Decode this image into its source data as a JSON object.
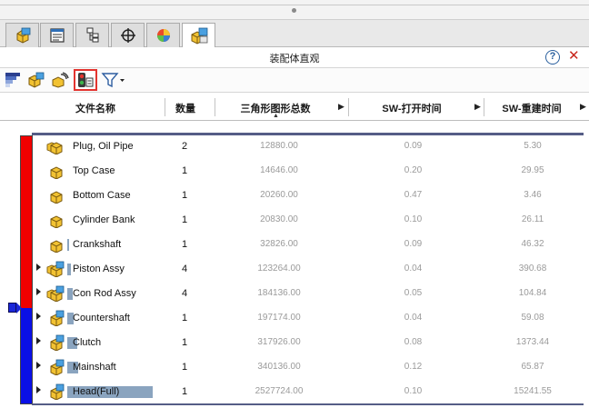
{
  "panel": {
    "title": "装配体直观"
  },
  "tabs": [
    {
      "icon": "feature-manager-icon"
    },
    {
      "icon": "property-manager-icon"
    },
    {
      "icon": "configuration-manager-icon"
    },
    {
      "icon": "dimxpert-icon"
    },
    {
      "icon": "display-manager-icon"
    },
    {
      "icon": "assembly-visualization-icon",
      "active": true
    }
  ],
  "toolbar": {
    "buttons": [
      {
        "icon": "gradient-spectrum-icon"
      },
      {
        "icon": "assembly-components-icon"
      },
      {
        "icon": "performance-evaluation-icon"
      },
      {
        "icon": "traffic-light-icon",
        "selected": true
      },
      {
        "icon": "filter-icon"
      }
    ]
  },
  "columns": {
    "name": "文件名称",
    "qty": "数量",
    "triangles": "三角形图形总数",
    "open_time": "SW-打开时间",
    "rebuild_time": "SW-重建时间"
  },
  "colors": {
    "bar_top": "#f00000",
    "bar_bottom": "#0a10e6",
    "name_bar": "#8aa4bf"
  },
  "rows": [
    {
      "name": "Plug, Oil Pipe",
      "qty": "2",
      "triangles": "12880.00",
      "open_time": "0.09",
      "rebuild_time": "5.30",
      "type": "part-multi",
      "expandable": false,
      "bar": 0
    },
    {
      "name": "Top Case",
      "qty": "1",
      "triangles": "14646.00",
      "open_time": "0.20",
      "rebuild_time": "29.95",
      "type": "part",
      "expandable": false,
      "bar": 0
    },
    {
      "name": "Bottom Case",
      "qty": "1",
      "triangles": "20260.00",
      "open_time": "0.47",
      "rebuild_time": "3.46",
      "type": "part",
      "expandable": false,
      "bar": 0
    },
    {
      "name": "Cylinder Bank",
      "qty": "1",
      "triangles": "20830.00",
      "open_time": "0.10",
      "rebuild_time": "26.11",
      "type": "part",
      "expandable": false,
      "bar": 0
    },
    {
      "name": "Crankshaft",
      "qty": "1",
      "triangles": "32826.00",
      "open_time": "0.09",
      "rebuild_time": "46.32",
      "type": "part",
      "expandable": false,
      "bar": 0.01
    },
    {
      "name": "Piston Assy",
      "qty": "4",
      "triangles": "123264.00",
      "open_time": "0.04",
      "rebuild_time": "390.68",
      "type": "assembly-multi",
      "expandable": true,
      "bar": 0.04
    },
    {
      "name": "Con Rod Assy",
      "qty": "4",
      "triangles": "184136.00",
      "open_time": "0.05",
      "rebuild_time": "104.84",
      "type": "assembly-multi",
      "expandable": true,
      "bar": 0.06
    },
    {
      "name": "Countershaft",
      "qty": "1",
      "triangles": "197174.00",
      "open_time": "0.04",
      "rebuild_time": "59.08",
      "type": "assembly",
      "expandable": true,
      "bar": 0.07
    },
    {
      "name": "Clutch",
      "qty": "1",
      "triangles": "317926.00",
      "open_time": "0.08",
      "rebuild_time": "1373.44",
      "type": "assembly",
      "expandable": true,
      "bar": 0.12
    },
    {
      "name": "Mainshaft",
      "qty": "1",
      "triangles": "340136.00",
      "open_time": "0.12",
      "rebuild_time": "65.87",
      "type": "assembly",
      "expandable": true,
      "bar": 0.13
    },
    {
      "name": "Head(Full)",
      "qty": "1",
      "triangles": "2527724.00",
      "open_time": "0.10",
      "rebuild_time": "15241.55",
      "type": "assembly",
      "expandable": true,
      "bar": 1
    }
  ]
}
